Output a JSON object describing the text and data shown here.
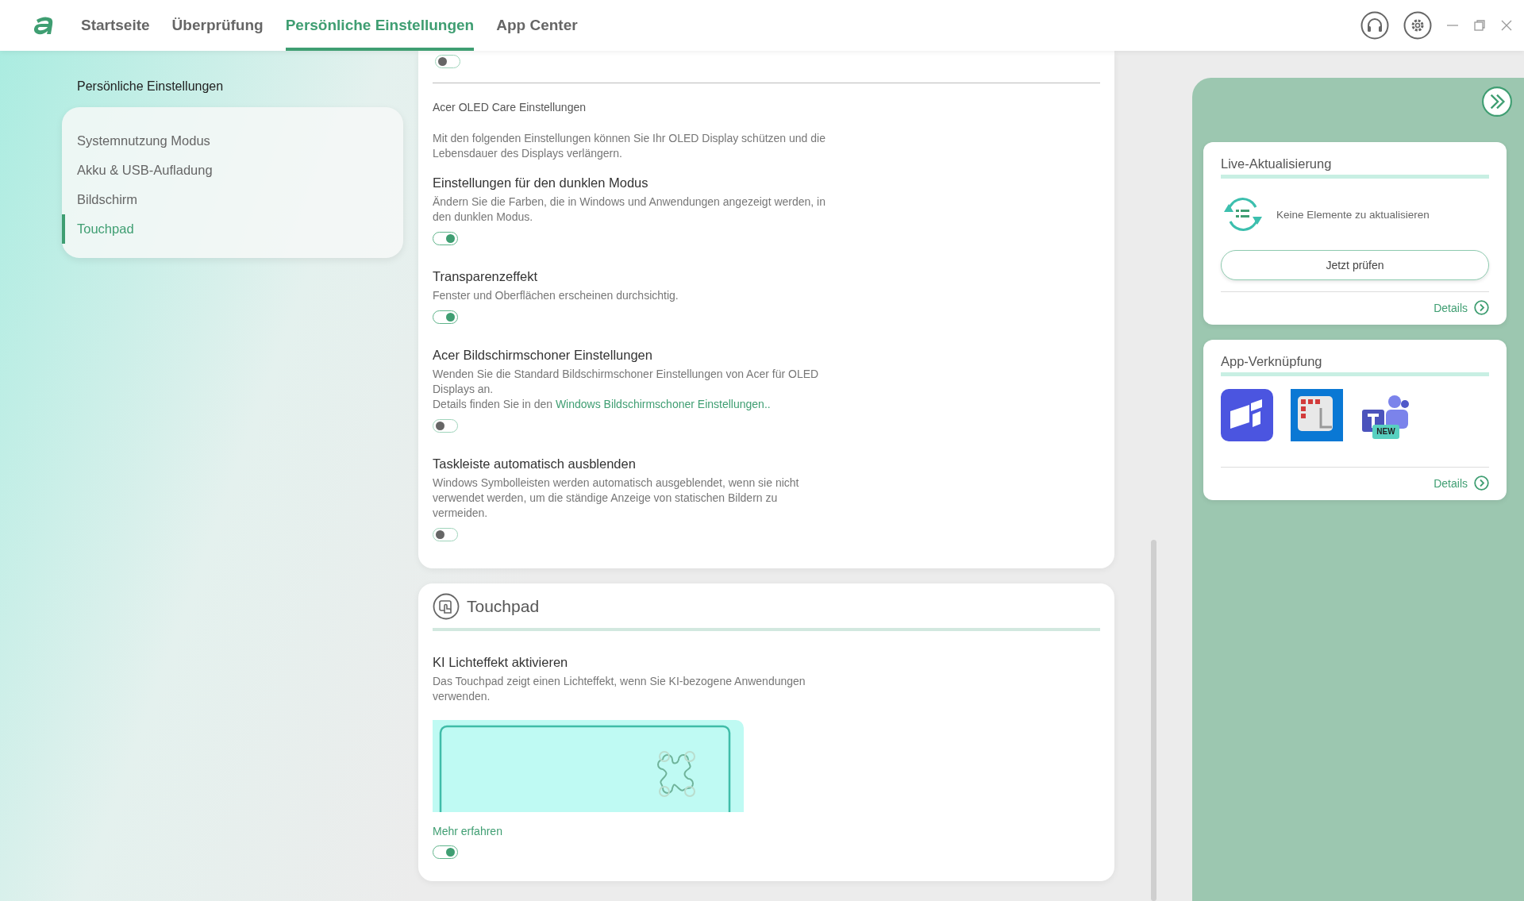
{
  "header": {
    "tabs": [
      {
        "label": "Startseite",
        "selected": false
      },
      {
        "label": "Überprüfung",
        "selected": false
      },
      {
        "label": "Persönliche Einstellungen",
        "selected": true
      },
      {
        "label": "App Center",
        "selected": false
      }
    ]
  },
  "sidebar": {
    "title": "Persönliche Einstellungen",
    "items": [
      {
        "label": "Systemnutzung Modus",
        "selected": false
      },
      {
        "label": "Akku & USB-Aufladung",
        "selected": false
      },
      {
        "label": "Bildschirm",
        "selected": false
      },
      {
        "label": "Touchpad",
        "selected": true
      }
    ]
  },
  "display_card": {
    "top_toggle": {
      "on": false
    },
    "section_title": "Acer OLED Care Einstellungen",
    "section_description": "Mit den folgenden Einstellungen können Sie Ihr OLED Display schützen und die Lebensdauer des Displays verlängern.",
    "settings": [
      {
        "title": "Einstellungen für den dunklen Modus",
        "description": "Ändern Sie die Farben, die in Windows und Anwendungen angezeigt werden, in den dunklen Modus.",
        "on": true
      },
      {
        "title": "Transparenzeffekt",
        "description": "Fenster und Oberflächen erscheinen durchsichtig.",
        "on": true
      },
      {
        "title": "Acer Bildschirmschoner Einstellungen",
        "description": "Wenden Sie die Standard Bildschirmschoner Einstellungen von Acer für OLED Displays an.",
        "note": "Details finden Sie in den ",
        "link": "Windows Bildschirmschoner Einstellungen..",
        "on": false
      },
      {
        "title": "Taskleiste automatisch ausblenden",
        "description": "Windows Symbolleisten werden automatisch ausgeblendet, wenn sie nicht verwendet werden, um die ständige Anzeige von statischen Bildern zu vermeiden.",
        "on": false
      }
    ]
  },
  "touchpad_card": {
    "title": "Touchpad",
    "setting": {
      "title": "KI Lichteffekt aktivieren",
      "description": "Das Touchpad zeigt einen Lichteffekt, wenn Sie KI-bezogene Anwendungen verwenden.",
      "link": "Mehr erfahren",
      "on": true
    }
  },
  "right_panel": {
    "live_update": {
      "title": "Live-Aktualisierung",
      "message": "Keine Elemente zu aktualisieren",
      "button": "Jetzt prüfen",
      "details": "Details"
    },
    "app_links": {
      "title": "App-Verknüpfung",
      "apps": [
        {
          "kind": "planner"
        },
        {
          "kind": "snipping"
        },
        {
          "kind": "teams",
          "badge": "NEW"
        }
      ],
      "details": "Details"
    }
  }
}
